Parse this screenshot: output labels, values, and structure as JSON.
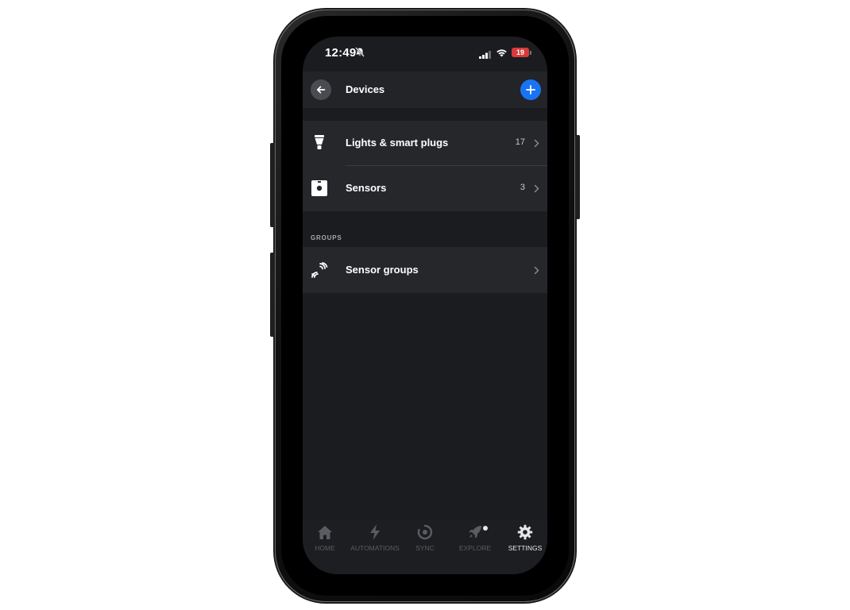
{
  "status_bar": {
    "time": "12:49",
    "battery_level": "19",
    "icons": [
      "bell-slash-icon",
      "cellular-signal-icon",
      "wifi-icon",
      "battery-icon"
    ]
  },
  "header": {
    "title": "Devices",
    "back_icon": "arrow-left-icon",
    "add_icon": "plus-icon"
  },
  "devices": [
    {
      "label": "Lights & smart plugs",
      "count": "17",
      "icon": "lightbulb-icon"
    },
    {
      "label": "Sensors",
      "count": "3",
      "icon": "sensor-icon"
    }
  ],
  "groups": {
    "section_label": "GROUPS",
    "items": [
      {
        "label": "Sensor groups",
        "icon": "sensor-waves-icon"
      }
    ]
  },
  "tabbar": {
    "tabs": [
      {
        "label": "HOME",
        "icon": "home-icon",
        "active": false
      },
      {
        "label": "AUTOMATIONS",
        "icon": "lightning-icon",
        "active": false
      },
      {
        "label": "SYNC",
        "icon": "sync-icon",
        "active": false
      },
      {
        "label": "EXPLORE",
        "icon": "rocket-icon",
        "active": false,
        "badge": true
      },
      {
        "label": "SETTINGS",
        "icon": "gear-icon",
        "active": true
      }
    ]
  },
  "colors": {
    "accent": "#1a73f5",
    "background": "#1b1c1f",
    "card": "#26272b",
    "battery_low": "#d83a3a"
  }
}
